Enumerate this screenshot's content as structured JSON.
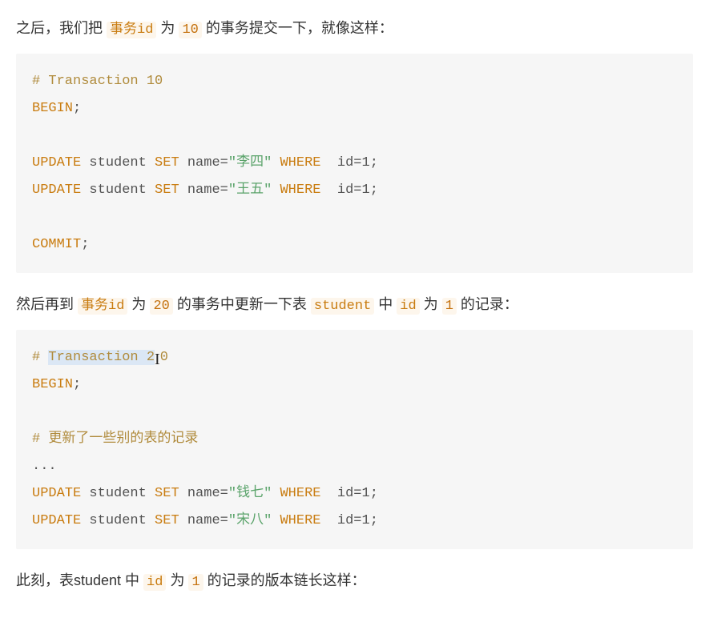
{
  "p1": {
    "prefix": "之后，我们把 ",
    "txid_label": "事务id",
    "mid1": " 为 ",
    "txid_val": "10",
    "suffix": " 的事务提交一下，就像这样："
  },
  "code1": {
    "comment_hash": "# ",
    "comment_text": "Transaction 10",
    "begin": "BEGIN",
    "update": "UPDATE",
    "student": " student ",
    "set": "SET",
    "name_eq": " name=",
    "str_lisi": "\"李四\"",
    "str_wangwu": "\"王五\"",
    "where": "WHERE",
    "id1": "  id=1",
    "semi": ";",
    "commit": "COMMIT"
  },
  "p2": {
    "prefix": "然后再到 ",
    "txid_label": "事务id",
    "mid1": " 为 ",
    "txid_val": "20",
    "mid2": " 的事务中更新一下表 ",
    "student": "student",
    "mid3": " 中 ",
    "id_label": "id",
    "mid4": " 为 ",
    "id_val": "1",
    "suffix": " 的记录："
  },
  "code2": {
    "comment_hash": "# ",
    "comment_sel": "Transaction 2",
    "comment_after_cursor": "0",
    "begin": "BEGIN",
    "comment2_hash": "# ",
    "comment2_text": "更新了一些别的表的记录",
    "dots": "...",
    "update": "UPDATE",
    "student": " student ",
    "set": "SET",
    "name_eq": " name=",
    "str_qianqi": "\"钱七\"",
    "str_songba": "\"宋八\"",
    "where": "WHERE",
    "id1": "  id=1",
    "semi": ";"
  },
  "p3": {
    "prefix": "此刻，表student 中 ",
    "id_label": "id",
    "mid": " 为 ",
    "id_val": "1",
    "suffix": " 的记录的版本链长这样："
  }
}
